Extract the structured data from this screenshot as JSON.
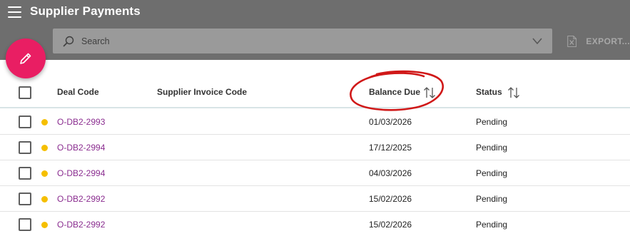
{
  "app": {
    "title": "Supplier Payments"
  },
  "search": {
    "placeholder": "Search"
  },
  "toolbar": {
    "export_label": "EXPORT..."
  },
  "table": {
    "columns": {
      "deal_code": "Deal Code",
      "supplier_invoice_code": "Supplier Invoice Code",
      "balance_due": "Balance Due",
      "status": "Status"
    },
    "rows": [
      {
        "deal_code": "O-DB2-2993",
        "supplier_invoice_code": "",
        "balance_due": "01/03/2026",
        "status": "Pending"
      },
      {
        "deal_code": "O-DB2-2994",
        "supplier_invoice_code": "",
        "balance_due": "17/12/2025",
        "status": "Pending"
      },
      {
        "deal_code": "O-DB2-2994",
        "supplier_invoice_code": "",
        "balance_due": "04/03/2026",
        "status": "Pending"
      },
      {
        "deal_code": "O-DB2-2992",
        "supplier_invoice_code": "",
        "balance_due": "15/02/2026",
        "status": "Pending"
      },
      {
        "deal_code": "O-DB2-2992",
        "supplier_invoice_code": "",
        "balance_due": "15/02/2026",
        "status": "Pending"
      }
    ]
  },
  "colors": {
    "appbar": "#6e6e6e",
    "fab": "#e91e63",
    "link": "#8a2c8f",
    "status_dot": "#f5bf00",
    "annotation": "#d01818"
  },
  "icons": {
    "menu": "hamburger-menu-icon",
    "search": "search-icon",
    "dropdown": "chevron-down-icon",
    "export": "excel-file-icon",
    "fab": "pencil-icon",
    "sort": "sort-arrows-icon"
  }
}
